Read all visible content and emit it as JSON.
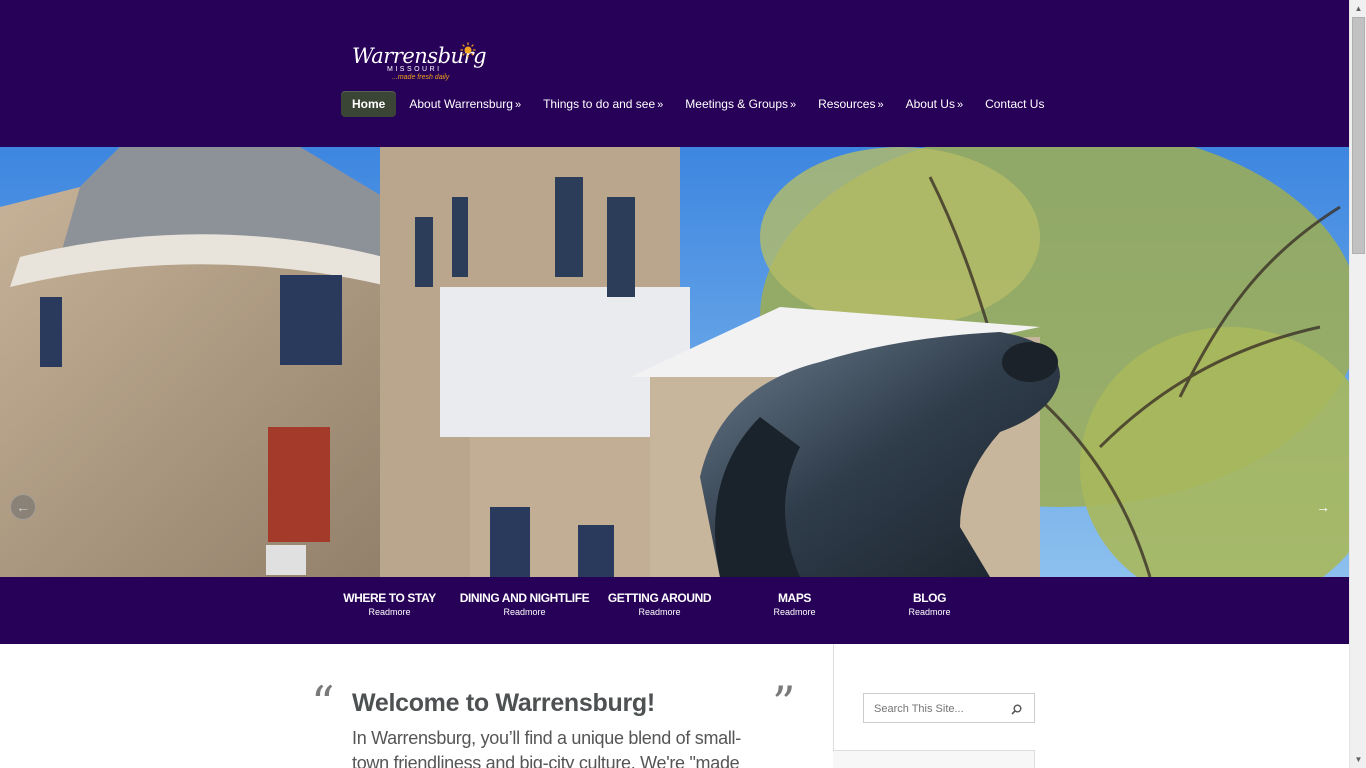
{
  "logo": {
    "name": "Warrensburg",
    "state": "MISSOURI",
    "tagline": "...made fresh daily"
  },
  "nav": [
    {
      "label": "Home",
      "arrow": "",
      "active": true
    },
    {
      "label": "About Warrensburg",
      "arrow": "»"
    },
    {
      "label": "Things to do and see",
      "arrow": "»"
    },
    {
      "label": "Meetings & Groups",
      "arrow": "»"
    },
    {
      "label": "Resources",
      "arrow": "»"
    },
    {
      "label": "About Us",
      "arrow": "»"
    },
    {
      "label": "Contact Us",
      "arrow": ""
    }
  ],
  "hero": {
    "prev_icon": "arrow-left-icon",
    "next_icon": "arrow-right-icon",
    "prev_glyph": "←",
    "next_glyph": "→"
  },
  "features": [
    {
      "title": "WHERE TO STAY",
      "link": "Readmore"
    },
    {
      "title": "DINING AND NIGHTLIFE",
      "link": "Readmore"
    },
    {
      "title": "GETTING AROUND",
      "link": "Readmore"
    },
    {
      "title": "MAPS",
      "link": "Readmore"
    },
    {
      "title": "BLOG",
      "link": "Readmore"
    }
  ],
  "welcome": {
    "open_quote": "“",
    "close_quote": "”",
    "title": "Welcome to Warrensburg!",
    "text": "In Warrensburg, you’ll find a unique blend of small-town friendliness and big-city culture. We're \"made"
  },
  "search": {
    "placeholder": "Search This Site...",
    "icon": "search-icon"
  },
  "colors": {
    "header_bg": "#270058",
    "nav_active_bg": "#3b4536",
    "tagline": "#f2a21c"
  }
}
